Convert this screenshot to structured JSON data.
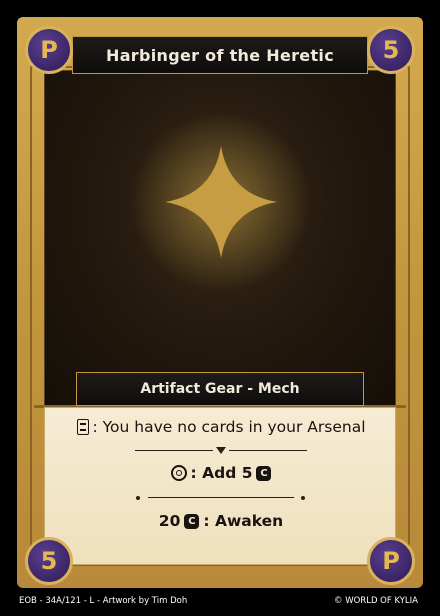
{
  "card": {
    "name": "Harbinger of the Heretic",
    "cost_top_left": "P",
    "cost_top_right": "5",
    "cost_bottom_left": "5",
    "cost_bottom_right": "P",
    "type_line": "Artifact Gear - Mech",
    "abilities": {
      "line1_text": ": You have no cards in your Arsenal",
      "line2_text": ": Add 5",
      "line3_cost": "20",
      "line3_text": ": Awaken"
    },
    "icons": {
      "arsenal": "arsenal-box-icon",
      "swirl": "swirl-icon",
      "currency": "c-currency-icon",
      "art": "four-point-star-icon"
    },
    "currency_symbol": "C"
  },
  "footer": {
    "left": "EOB - 34A/121 - L - Artwork by Tim Doh",
    "right": "© WORLD OF KYLIA"
  },
  "colors": {
    "frame_gold": "#c79b45",
    "cost_purple": "#3a2566",
    "cost_text_gold": "#e3b950",
    "title_bar": "#151210",
    "text_box": "#f3e6c8"
  }
}
